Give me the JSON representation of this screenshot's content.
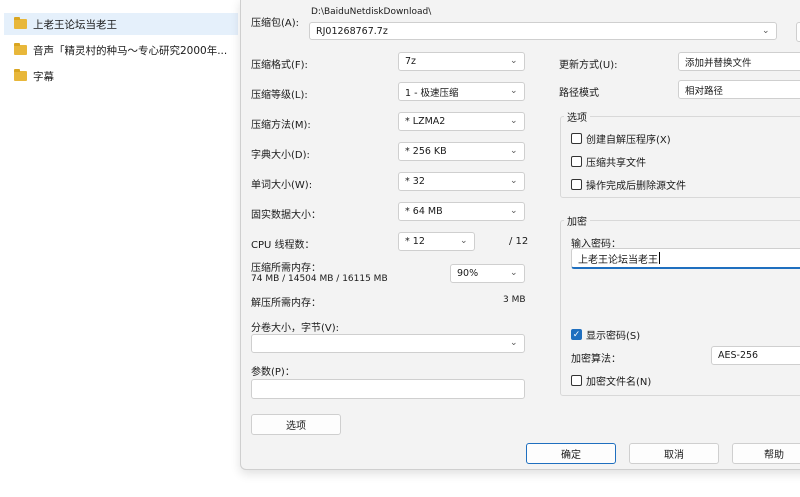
{
  "explorer": {
    "items": [
      {
        "label": "上老王论坛当老王",
        "selected": true
      },
      {
        "label": "音声「精灵村的种马～专心研究2000年...",
        "selected": false
      },
      {
        "label": "字幕",
        "selected": false
      }
    ]
  },
  "dialog": {
    "archive_label": "压缩包(A):",
    "archive_path": "D:\\BaiduNetdiskDownload\\",
    "archive_name": "RJ01268767.7z",
    "format_label": "压缩格式(F):",
    "format_value": "7z",
    "level_label": "压缩等级(L):",
    "level_value": "1 - 极速压缩",
    "method_label": "压缩方法(M):",
    "method_value": "* LZMA2",
    "dict_label": "字典大小(D):",
    "dict_value": "* 256 KB",
    "word_label": "单词大小(W):",
    "word_value": "* 32",
    "solid_label": "固实数据大小：",
    "solid_value": "* 64 MB",
    "cpu_label": "CPU 线程数：",
    "cpu_value": "* 12",
    "cpu_total": "/ 12",
    "mem_comp_label": "压缩所需内存：",
    "mem_comp_value": "74 MB / 14504 MB / 16115 MB",
    "mem_comp_pct": "90%",
    "mem_decomp_label": "解压所需内存：",
    "mem_decomp_value": "3 MB",
    "split_label": "分卷大小，字节(V):",
    "split_value": "",
    "params_label": "参数(P)：",
    "params_value": "",
    "options_button": "选项",
    "update_label": "更新方式(U):",
    "update_value": "添加并替换文件",
    "path_label": "路径模式",
    "path_value": "相对路径",
    "options_group": "选项",
    "opt_sfx": "创建自解压程序(X)",
    "opt_shared": "压缩共享文件",
    "opt_delete": "操作完成后删除源文件",
    "encrypt_group": "加密",
    "password_label": "输入密码：",
    "password_value": "上老王论坛当老王",
    "show_password": "显示密码(S)",
    "enc_method_label": "加密算法：",
    "enc_method_value": "AES-256",
    "enc_names": "加密文件名(N)",
    "ok_button": "确定",
    "cancel_button": "取消",
    "help_button": "帮助"
  }
}
